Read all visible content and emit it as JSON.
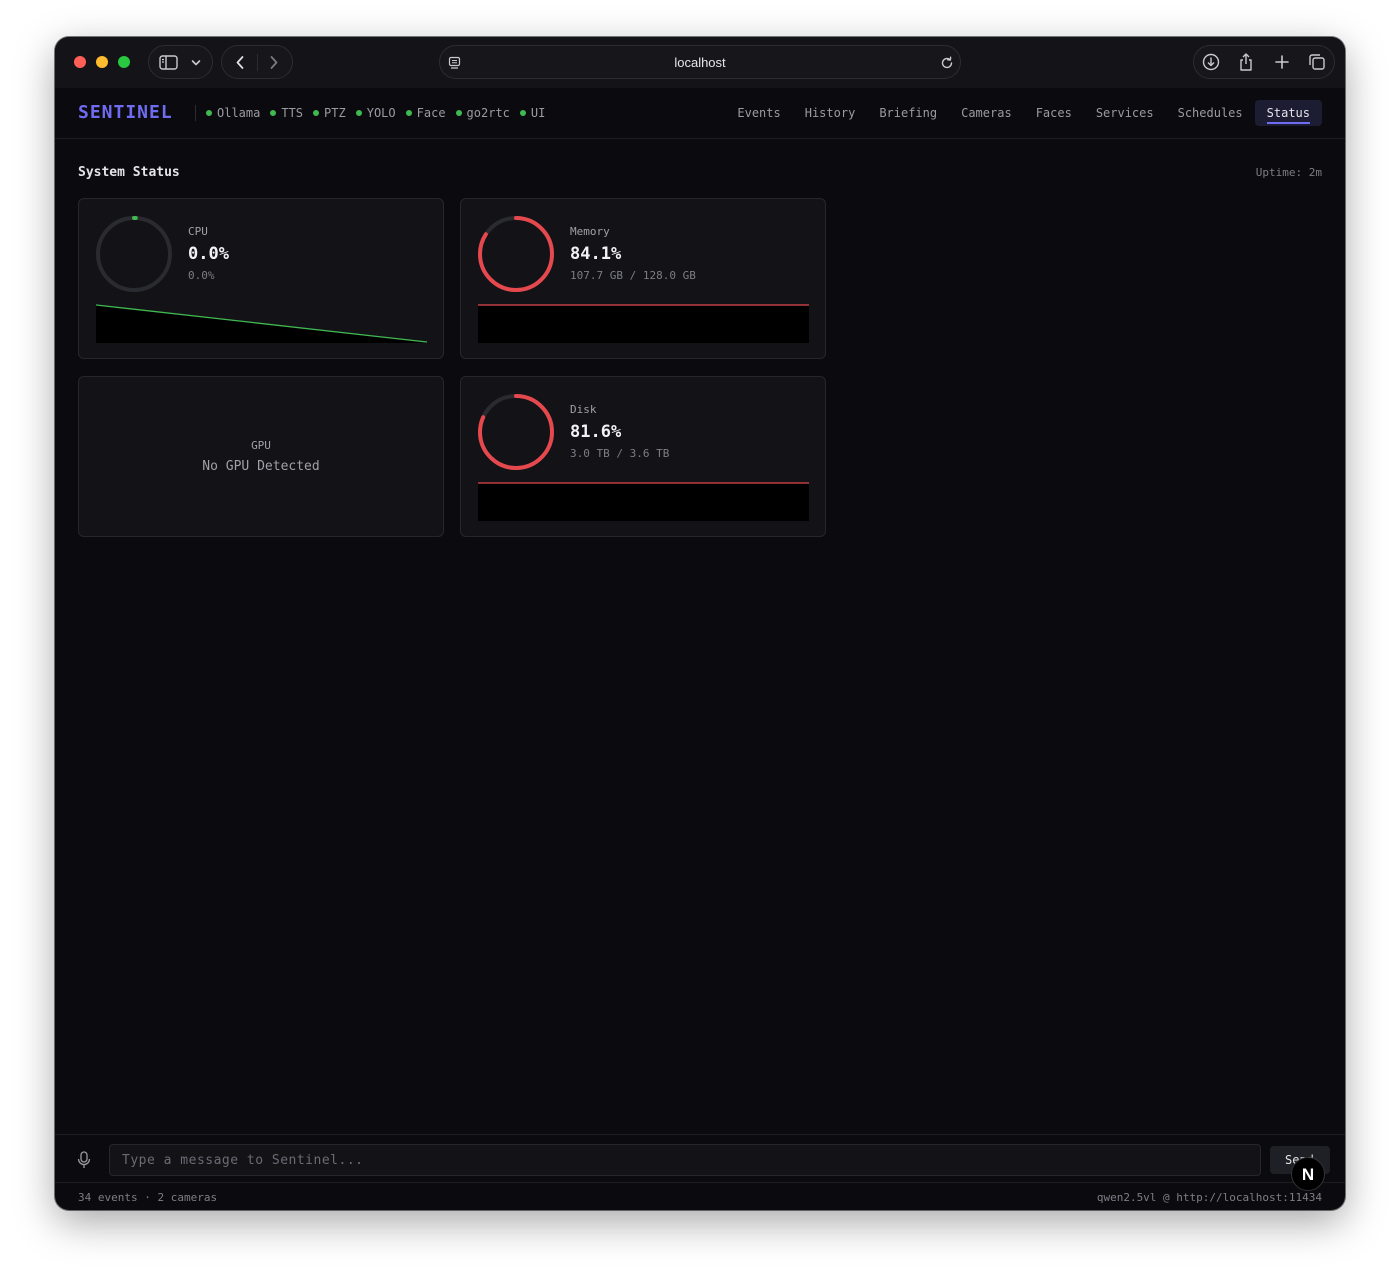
{
  "browser": {
    "url": "localhost",
    "icons": {
      "sidebar": "sidebar-icon",
      "chevron": "chevron-down-icon",
      "back": "back-icon",
      "forward": "forward-icon",
      "page": "page-icon",
      "reload": "reload-icon",
      "download": "download-icon",
      "share": "share-icon",
      "new_tab": "plus-icon",
      "tabs": "tabs-overview-icon"
    }
  },
  "header": {
    "brand": "SENTINEL",
    "services": [
      {
        "name": "Ollama",
        "status": "ok"
      },
      {
        "name": "TTS",
        "status": "ok"
      },
      {
        "name": "PTZ",
        "status": "ok"
      },
      {
        "name": "YOLO",
        "status": "ok"
      },
      {
        "name": "Face",
        "status": "ok"
      },
      {
        "name": "go2rtc",
        "status": "ok"
      },
      {
        "name": "UI",
        "status": "ok"
      }
    ],
    "tabs": [
      "Events",
      "History",
      "Briefing",
      "Cameras",
      "Faces",
      "Services",
      "Schedules",
      "Status"
    ],
    "active_tab": "Status"
  },
  "status": {
    "title": "System Status",
    "uptime": "Uptime: 2m",
    "cpu": {
      "label": "CPU",
      "value": "0.0%",
      "sub": "0.0%",
      "percent": 0.0,
      "color": "#3fb950"
    },
    "memory": {
      "label": "Memory",
      "value": "84.1%",
      "sub": "107.7 GB / 128.0 GB",
      "percent": 84.1,
      "color": "#e5484d"
    },
    "gpu": {
      "label": "GPU",
      "message": "No GPU Detected"
    },
    "disk": {
      "label": "Disk",
      "value": "81.6%",
      "sub": "3.0 TB / 3.6 TB",
      "percent": 81.6,
      "color": "#e5484d"
    }
  },
  "chat": {
    "placeholder": "Type a message to Sentinel...",
    "send_label": "Send"
  },
  "footer": {
    "left": "34 events · 2 cameras",
    "right": "qwen2.5vl @ http://localhost:11434"
  },
  "colors": {
    "accent": "#6f6cf2",
    "ok": "#3fb950",
    "danger": "#e5484d",
    "background": "#0b0b0f"
  }
}
